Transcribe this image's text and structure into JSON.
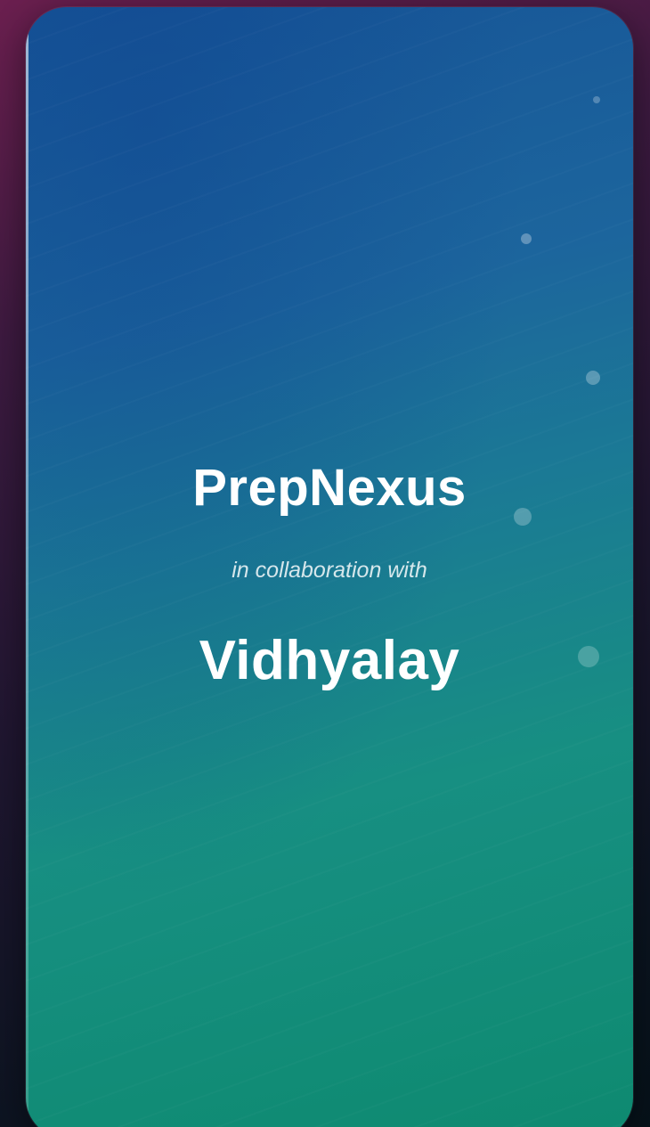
{
  "splash": {
    "app_name": "PrepNexus",
    "collaboration_text": "in collaboration with",
    "partner_name": "Vidhyalay"
  },
  "colors": {
    "gradient_top": "#175597",
    "gradient_bottom": "#0e8a70",
    "text": "#ffffff"
  }
}
